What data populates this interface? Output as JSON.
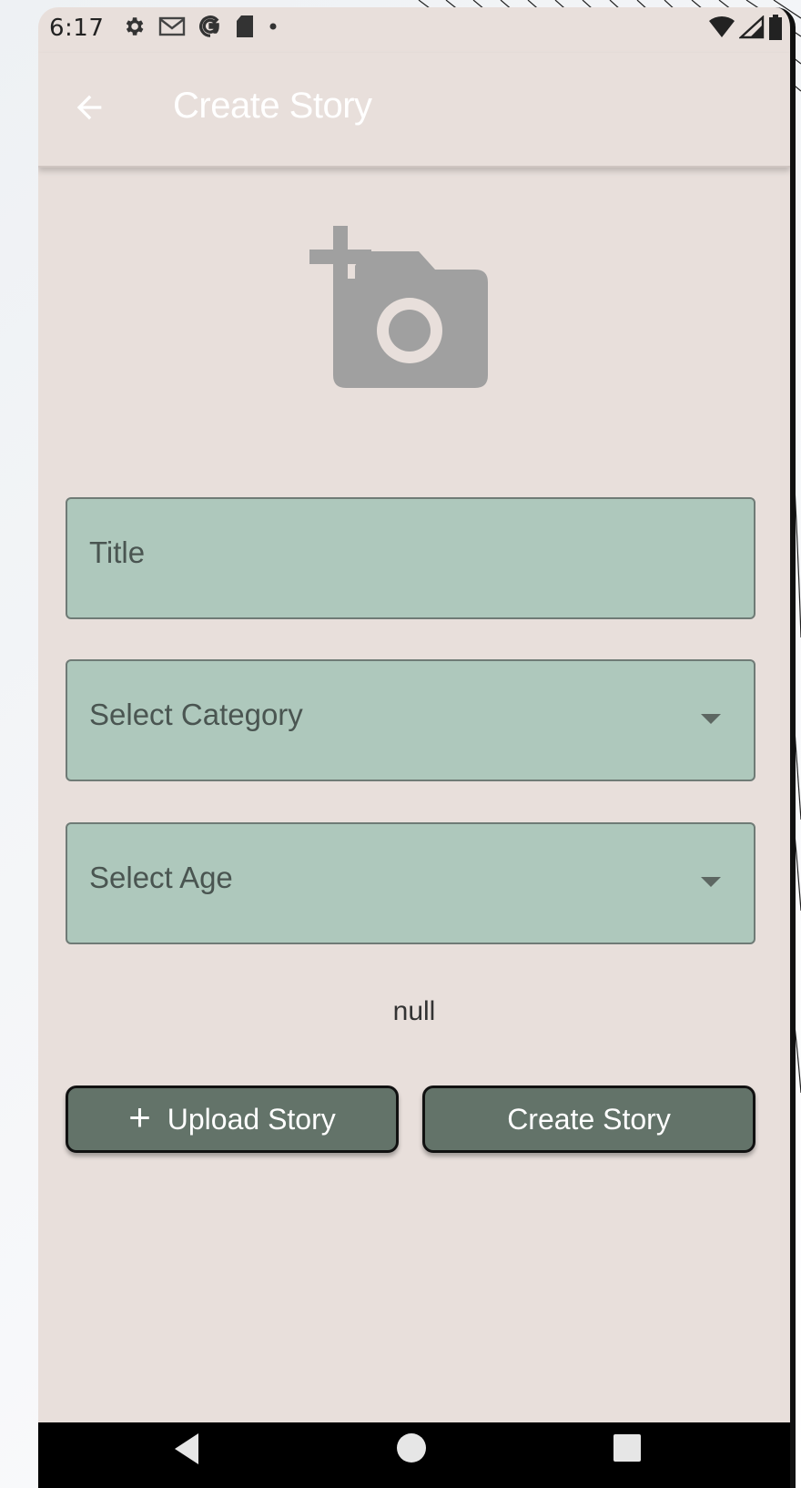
{
  "status_bar": {
    "time": "6:17",
    "left_icons": [
      "gear-icon",
      "gmail-icon",
      "google-icon",
      "sd-card-icon",
      "dot-icon"
    ],
    "right_icons": [
      "wifi-icon",
      "signal-icon",
      "battery-icon"
    ]
  },
  "app_bar": {
    "title": "Create Story",
    "back_icon": "arrow-left-icon"
  },
  "image_picker": {
    "icon": "add-photo-icon"
  },
  "form": {
    "title_field": {
      "placeholder": "Title"
    },
    "category_select": {
      "placeholder": "Select Category"
    },
    "age_select": {
      "placeholder": "Select Age"
    }
  },
  "status_text": "null",
  "buttons": {
    "upload_story": {
      "label": "Upload Story",
      "icon": "plus-icon",
      "icon_glyph": "+"
    },
    "create_story": {
      "label": "Create Story"
    }
  },
  "nav_bar": {
    "icons": [
      "nav-back-icon",
      "nav-home-icon",
      "nav-recent-icon"
    ]
  },
  "colors": {
    "background": "#e8dfdb",
    "field_fill": "#aec8bc",
    "button_fill": "#637369",
    "icon_gray": "#a0a0a0"
  }
}
